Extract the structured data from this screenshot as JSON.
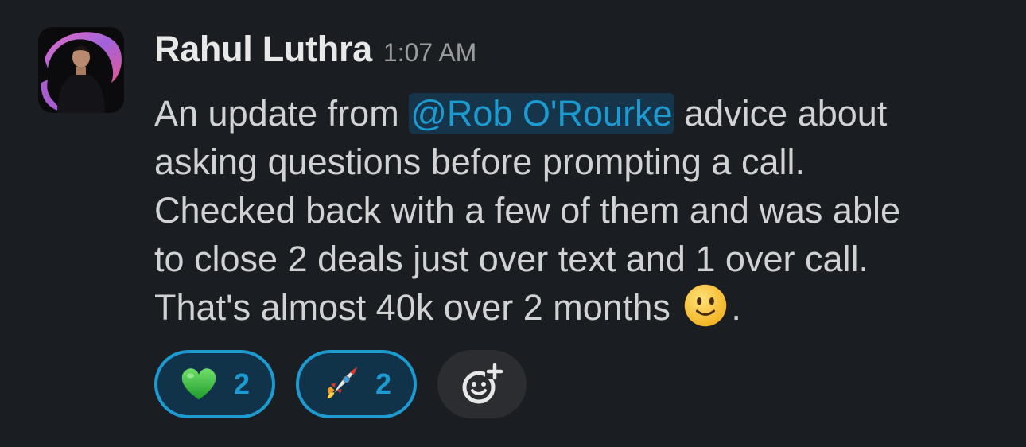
{
  "message": {
    "author": "Rahul Luthra",
    "timestamp": "1:07 AM",
    "lines": [
      {
        "before": "An update from ",
        "mention": "@Rob O'Rourke",
        "after": " advice about"
      },
      {
        "text": "asking questions before prompting a call."
      },
      {
        "text": "Checked back with a few of them and was able"
      },
      {
        "text": "to close 2 deals just over text and 1 over call."
      },
      {
        "before": "That's almost 40k over 2 months ",
        "emoji": "slightly-smiling-face",
        "after": "."
      }
    ]
  },
  "reactions": [
    {
      "emoji": "green-heart",
      "count": "2"
    },
    {
      "emoji": "rocket",
      "count": "2"
    }
  ],
  "add_reaction": {
    "icon": "add-reaction-icon"
  },
  "colors": {
    "background": "#1a1d21",
    "text": "#d1d2d3",
    "mention_text": "#1d9bd1",
    "mention_bg": "#16344a",
    "reaction_border": "#1d9bd1",
    "reaction_bg": "#11334a",
    "add_reaction_bg": "#2c2d30"
  }
}
